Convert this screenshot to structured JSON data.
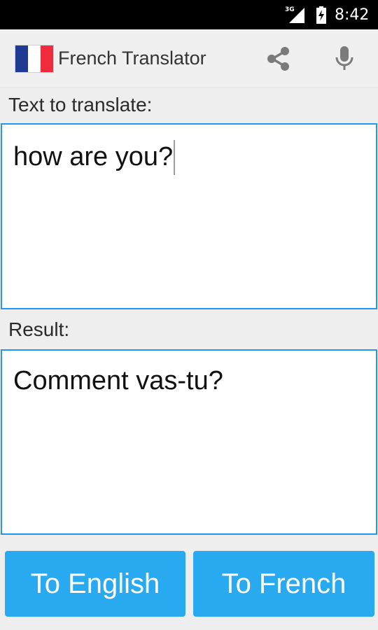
{
  "status_bar": {
    "network": "3G",
    "time": "8:42"
  },
  "app_bar": {
    "title": "French Translator",
    "icons": [
      "flag-france-icon",
      "share-icon",
      "microphone-icon"
    ]
  },
  "input": {
    "label": "Text to translate:",
    "value": "how are you?"
  },
  "result": {
    "label": "Result:",
    "value": "Comment vas-tu?"
  },
  "buttons": {
    "to_english": "To English",
    "to_french": "To French"
  },
  "colors": {
    "accent": "#2196f3",
    "button": "#29a9f0",
    "flag_blue": "#1f3a93",
    "flag_red": "#ef2b3d"
  }
}
